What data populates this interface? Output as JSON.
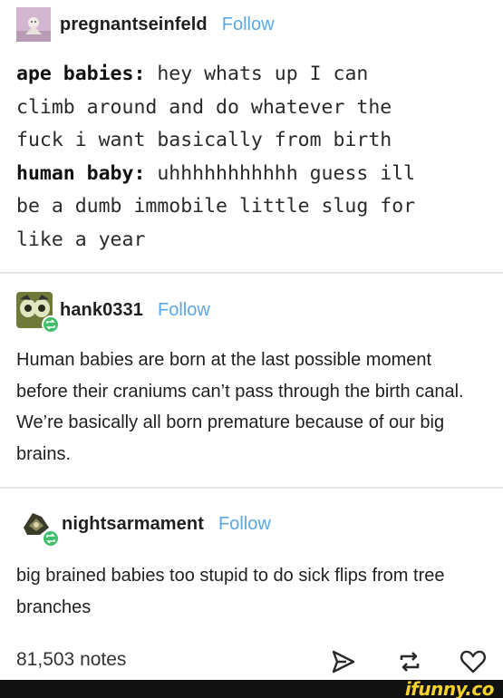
{
  "posts": [
    {
      "username": "pregnantseinfeld",
      "follow_label": "Follow",
      "lines": [
        {
          "speaker": "ape babies:",
          "text": " hey whats up I can\nclimb around and do whatever the\nfuck i want basically from birth"
        },
        {
          "speaker": "human baby:",
          "text": " uhhhhhhhhhhh guess ill\nbe a dumb immobile little slug for\nlike a year"
        }
      ]
    },
    {
      "username": "hank0331",
      "follow_label": "Follow",
      "body": "Human babies are born at the last possible moment before their craniums can’t pass through the birth canal. We’re basically all born premature because of our big brains."
    },
    {
      "username": "nightsarmament",
      "follow_label": "Follow",
      "body": "big brained babies too stupid to do sick flips from tree branches"
    }
  ],
  "footer": {
    "notes": "81,503 notes",
    "icons": [
      "share-icon",
      "reblog-icon",
      "heart-icon"
    ]
  },
  "watermark": {
    "text": "ifunny.co",
    "color": "#f4d22a"
  },
  "colors": {
    "follow": "#5aa9e6",
    "reblog_badge": "#3fbf6a",
    "divider": "#e6e6e6"
  }
}
